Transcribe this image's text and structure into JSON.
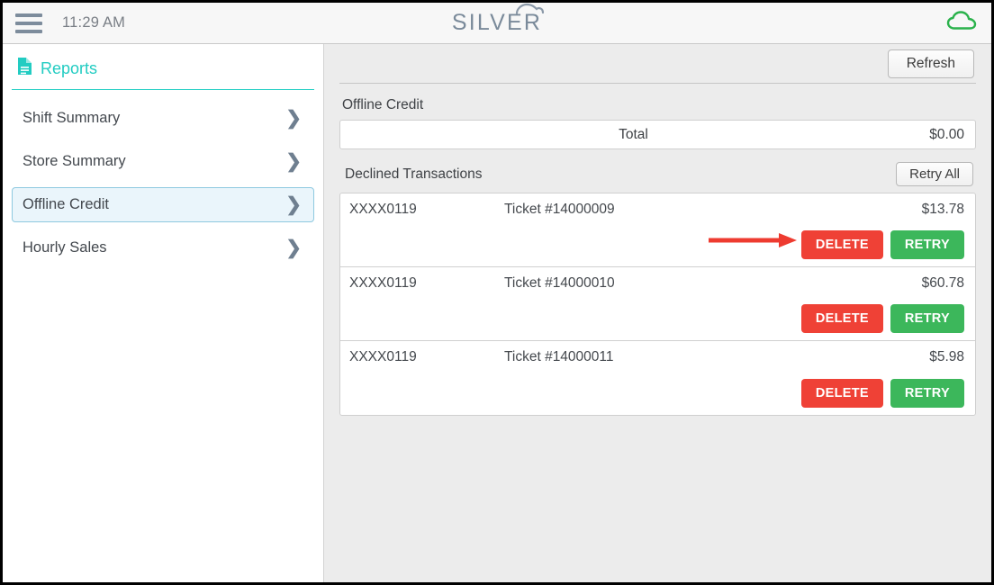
{
  "topbar": {
    "menu_icon": "hamburger-menu-icon",
    "time": "11:29 AM",
    "brand": "SILVER",
    "brand_icon": "cloud-swoosh-icon",
    "status_icon": "cloud-icon",
    "cloud_color": "#2bb24c"
  },
  "sidebar": {
    "header": {
      "icon": "document-report-icon",
      "title": "Reports",
      "accent_color": "#22ccc2"
    },
    "items": [
      {
        "label": "Shift Summary",
        "chevron": "chevron-right-icon",
        "selected": false
      },
      {
        "label": "Store Summary",
        "chevron": "chevron-right-icon",
        "selected": false
      },
      {
        "label": "Offline Credit",
        "chevron": "chevron-right-icon",
        "selected": true
      },
      {
        "label": "Hourly Sales",
        "chevron": "chevron-right-icon",
        "selected": false
      }
    ]
  },
  "main": {
    "refresh_label": "Refresh",
    "offline_credit": {
      "section_label": "Offline Credit",
      "total_label": "Total",
      "total_amount": "$0.00"
    },
    "declined": {
      "section_label": "Declined Transactions",
      "retry_all_label": "Retry All",
      "delete_label": "DELETE",
      "retry_label": "RETRY",
      "delete_color": "#ef4136",
      "retry_color": "#3cb75b",
      "transactions": [
        {
          "card": "XXXX0119",
          "ticket": "Ticket #14000009",
          "amount": "$13.78",
          "annotated": true
        },
        {
          "card": "XXXX0119",
          "ticket": "Ticket #14000010",
          "amount": "$60.78",
          "annotated": false
        },
        {
          "card": "XXXX0119",
          "ticket": "Ticket #14000011",
          "amount": "$5.98",
          "annotated": false
        }
      ]
    }
  },
  "annotation": {
    "type": "arrow-pointer",
    "color": "#ee3b30",
    "points_to": "DELETE"
  }
}
